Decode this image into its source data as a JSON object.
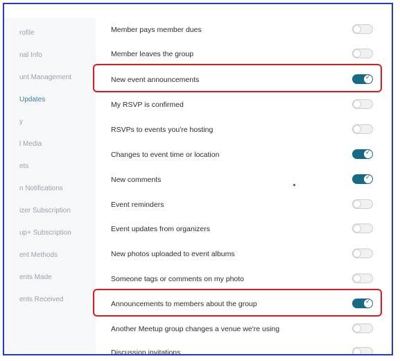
{
  "sidebar": {
    "items": [
      {
        "label": "rofile",
        "active": false
      },
      {
        "label": "nal Info",
        "active": false
      },
      {
        "label": "unt Management",
        "active": false
      },
      {
        "label": "Updates",
        "active": true
      },
      {
        "label": "y",
        "active": false
      },
      {
        "label": "l Media",
        "active": false
      },
      {
        "label": "ets",
        "active": false
      },
      {
        "label": "n Notifications",
        "active": false
      },
      {
        "label": "izer Subscription",
        "active": false
      },
      {
        "label": "up+ Subscription",
        "active": false
      },
      {
        "label": "ent Methods",
        "active": false
      },
      {
        "label": "ents Made",
        "active": false
      },
      {
        "label": "ents Received",
        "active": false
      }
    ]
  },
  "settings": [
    {
      "label": "Member pays member dues",
      "enabled": false
    },
    {
      "label": "Member leaves the group",
      "enabled": false
    },
    {
      "label": "New event announcements",
      "enabled": true,
      "highlighted": true
    },
    {
      "label": "My RSVP is confirmed",
      "enabled": false
    },
    {
      "label": "RSVPs to events you're hosting",
      "enabled": false
    },
    {
      "label": "Changes to event time or location",
      "enabled": true
    },
    {
      "label": "New comments",
      "enabled": true
    },
    {
      "label": "Event reminders",
      "enabled": false
    },
    {
      "label": "Event updates from organizers",
      "enabled": false
    },
    {
      "label": "New photos uploaded to event albums",
      "enabled": false
    },
    {
      "label": "Someone tags or comments on my photo",
      "enabled": false
    },
    {
      "label": "Announcements to members about the group",
      "enabled": true,
      "highlighted": true
    },
    {
      "label": "Another Meetup group changes a venue we're using",
      "enabled": false
    },
    {
      "label": "Discussion invitations",
      "enabled": false
    }
  ],
  "colors": {
    "toggle_on": "#176a84",
    "highlight": "#e0191f",
    "frame_border": "#2137d6",
    "sidebar_active": "#3a7ea0"
  }
}
